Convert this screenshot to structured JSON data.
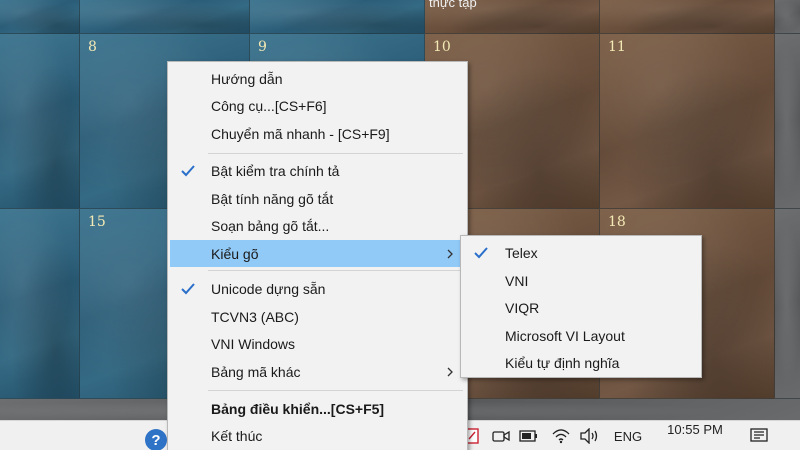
{
  "calendar": {
    "days": [
      "8",
      "9",
      "10",
      "11",
      "15",
      "18"
    ],
    "note": "thực tập"
  },
  "menu": {
    "items": [
      {
        "label": "Hướng dẫn"
      },
      {
        "label": "Công cụ...[CS+F6]"
      },
      {
        "label": "Chuyển mã nhanh - [CS+F9]"
      },
      {
        "label": "Bật kiểm tra chính tả",
        "checked": true
      },
      {
        "label": "Bật tính năng gõ tắt"
      },
      {
        "label": "Soạn bảng gõ tắt..."
      },
      {
        "label": "Kiểu gõ",
        "submenu": true,
        "highlighted": true
      },
      {
        "label": "Unicode dựng sẵn",
        "checked": true
      },
      {
        "label": "TCVN3 (ABC)"
      },
      {
        "label": "VNI Windows"
      },
      {
        "label": "Bảng mã khác",
        "submenu": true
      },
      {
        "label": "Bảng điều khiển...[CS+F5]",
        "bold": true
      },
      {
        "label": "Kết thúc"
      }
    ]
  },
  "submenu": {
    "items": [
      {
        "label": "Telex",
        "checked": true
      },
      {
        "label": "VNI"
      },
      {
        "label": "VIQR"
      },
      {
        "label": "Microsoft VI Layout"
      },
      {
        "label": "Kiểu tự định nghĩa"
      }
    ]
  },
  "taskbar": {
    "help_glyph": "?",
    "language": "ENG",
    "time": "10:55 PM"
  },
  "colors": {
    "highlight": "#91c9f7",
    "check": "#2a6fc9",
    "menu_bg": "#f2f2f2"
  },
  "icons": [
    "check-icon",
    "submenu-arrow-icon",
    "help-icon",
    "flag-icon",
    "camera-icon",
    "battery-icon",
    "wifi-icon",
    "volume-icon",
    "notification-icon"
  ]
}
